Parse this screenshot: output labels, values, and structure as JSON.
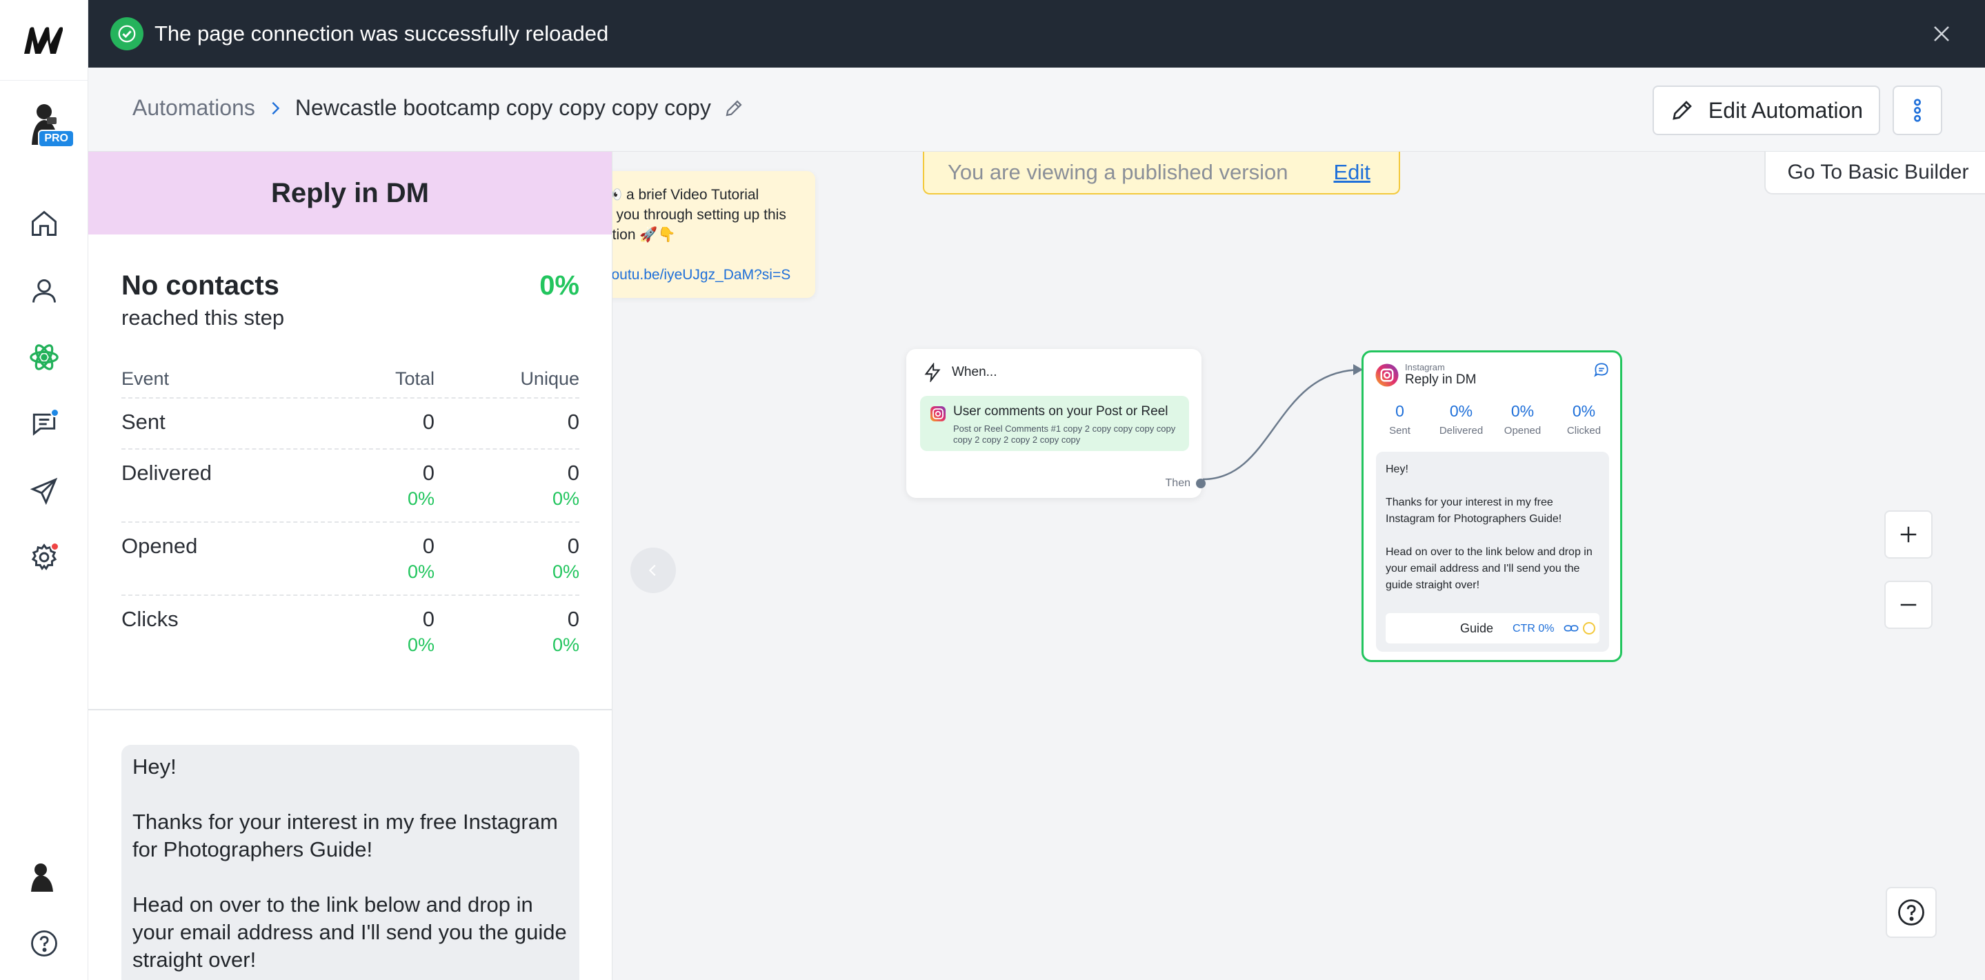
{
  "toast": {
    "message": "The page connection was successfully reloaded"
  },
  "breadcrumb": {
    "root": "Automations",
    "current": "Newcastle bootcamp copy copy copy copy"
  },
  "header": {
    "edit_button": "Edit Automation"
  },
  "account": {
    "badge": "PRO"
  },
  "canvas": {
    "banner_text": "You are viewing a published version",
    "banner_link": "Edit",
    "basic_builder": "Go To Basic Builder",
    "note": {
      "line1": "👀 a brief Video Tutorial",
      "line2": "g you through setting up this",
      "line3": "ation 🚀👇",
      "link": "youtu.be/iyeUJgz_DaM?si=S"
    },
    "when_node": {
      "title": "When...",
      "trigger": "User comments on your Post or Reel",
      "trigger_sub": "Post or Reel Comments #1 copy 2 copy copy copy copy copy 2 copy 2 copy 2 copy copy",
      "then": "Then"
    },
    "reply_node": {
      "platform": "Instagram",
      "title": "Reply in DM",
      "stats": [
        {
          "value": "0",
          "label": "Sent"
        },
        {
          "value": "0%",
          "label": "Delivered"
        },
        {
          "value": "0%",
          "label": "Opened"
        },
        {
          "value": "0%",
          "label": "Clicked"
        }
      ],
      "message": "Hey!\n\nThanks for your interest in my free Instagram for Photographers Guide!\n\nHead on over to the link below and drop in your email address and I'll send you the guide straight over!",
      "button_label": "Guide",
      "ctr": "CTR 0%"
    }
  },
  "panel": {
    "title": "Reply in DM",
    "summary_heading": "No contacts",
    "summary_sub": "reached this step",
    "summary_pct": "0%",
    "columns": {
      "event": "Event",
      "total": "Total",
      "unique": "Unique"
    },
    "rows": [
      {
        "event": "Sent",
        "total": "0",
        "unique": "0",
        "total_pct": "",
        "unique_pct": ""
      },
      {
        "event": "Delivered",
        "total": "0",
        "unique": "0",
        "total_pct": "0%",
        "unique_pct": "0%"
      },
      {
        "event": "Opened",
        "total": "0",
        "unique": "0",
        "total_pct": "0%",
        "unique_pct": "0%"
      },
      {
        "event": "Clicks",
        "total": "0",
        "unique": "0",
        "total_pct": "0%",
        "unique_pct": "0%"
      }
    ],
    "message": "Hey!\n\nThanks for your interest in my free Instagram for Photographers Guide!\n\nHead on over to the link below and drop in your email address and I'll send you the guide straight over!"
  },
  "colors": {
    "accent_green": "#22c55e",
    "accent_blue": "#1e6fd9",
    "toast_bg": "#222a35",
    "panel_header": "#f0d4f4",
    "banner_bg": "#fff7d1"
  },
  "icons": {
    "logo": "manychat-logo-icon",
    "nav": [
      "home-icon",
      "contacts-icon",
      "automation-icon",
      "live-chat-icon",
      "broadcast-icon",
      "settings-icon"
    ],
    "bottom": [
      "profile-avatar-icon",
      "help-icon"
    ]
  }
}
